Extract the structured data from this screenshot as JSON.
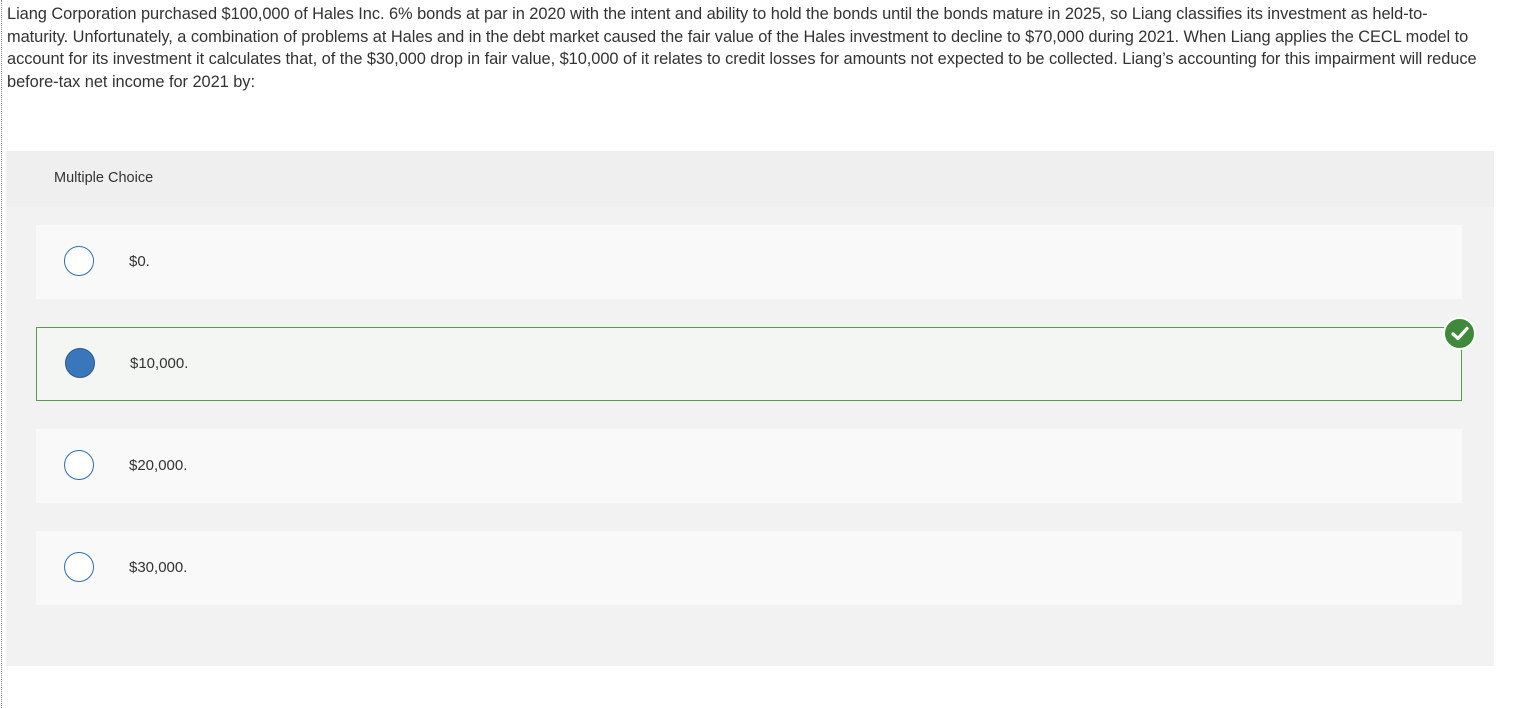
{
  "question": {
    "text": "Liang Corporation purchased $100,000 of Hales Inc. 6% bonds at par in 2020 with the intent and ability to hold the bonds until the bonds mature in 2025, so Liang classifies its investment as held-to-maturity. Unfortunately, a combination of problems at Hales and in the debt market caused the fair value of the Hales investment to decline to $70,000 during 2021. When Liang applies the CECL model to account for its investment it calculates that, of the $30,000 drop in fair value, $10,000 of it relates to credit losses for amounts not expected to be collected. Liang’s accounting for this impairment will reduce before-tax net income for 2021 by:"
  },
  "multiple_choice": {
    "header_label": "Multiple Choice",
    "choices": [
      {
        "label": "$0.",
        "selected": false
      },
      {
        "label": "$10,000.",
        "selected": true,
        "correct": true
      },
      {
        "label": "$20,000.",
        "selected": false
      },
      {
        "label": "$30,000.",
        "selected": false
      }
    ]
  },
  "icons": {
    "correct_indicator": "checkmark-circle-icon"
  },
  "colors": {
    "radio_border": "#2c6fb3",
    "radio_selected_fill": "#3a76bb",
    "correct_green": "#3f8a3a",
    "selected_border": "#5a9a4e"
  }
}
